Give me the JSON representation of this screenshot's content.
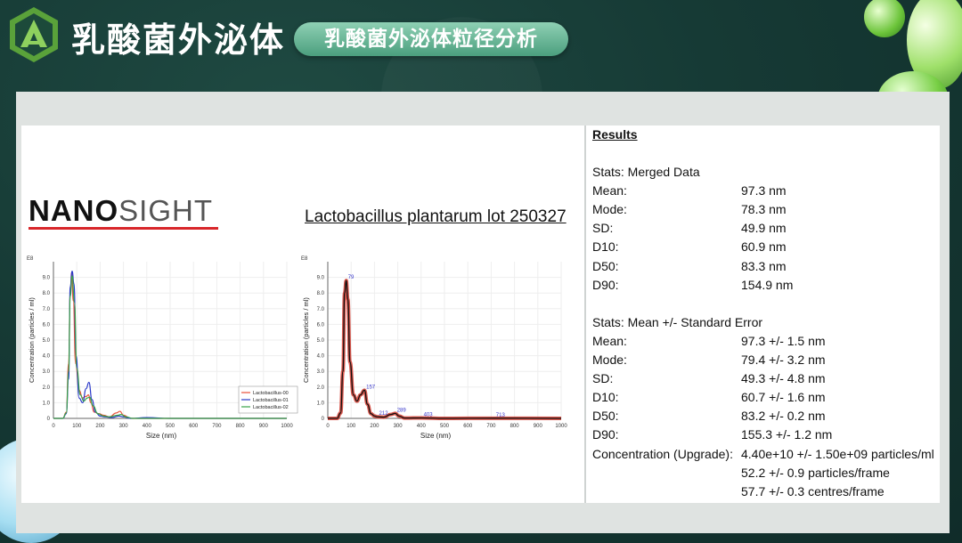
{
  "header": {
    "brand_title": "乳酸菌外泌体",
    "section_pill": "乳酸菌外泌体粒径分析"
  },
  "report": {
    "logo_text_bold": "NANO",
    "logo_text_light": "SIGHT",
    "sample_title": "Lactobacillus plantarum lot 250327"
  },
  "results": {
    "heading": "Results",
    "merged_heading": "Stats: Merged Data",
    "merged": [
      {
        "label": "Mean:",
        "value": "97.3 nm"
      },
      {
        "label": "Mode:",
        "value": "78.3 nm"
      },
      {
        "label": "SD:",
        "value": "49.9 nm"
      },
      {
        "label": "D10:",
        "value": "60.9 nm"
      },
      {
        "label": "D50:",
        "value": "83.3 nm"
      },
      {
        "label": "D90:",
        "value": "154.9 nm"
      }
    ],
    "se_heading": "Stats: Mean +/- Standard Error",
    "se": [
      {
        "label": "Mean:",
        "value": "97.3 +/- 1.5 nm"
      },
      {
        "label": "Mode:",
        "value": "79.4 +/- 3.2 nm"
      },
      {
        "label": "SD:",
        "value": "49.3 +/- 4.8 nm"
      },
      {
        "label": "D10:",
        "value": "60.7 +/- 1.6 nm"
      },
      {
        "label": "D50:",
        "value": "83.2 +/- 0.2 nm"
      },
      {
        "label": "D90:",
        "value": "155.3 +/- 1.2 nm"
      },
      {
        "label": "Concentration (Upgrade):",
        "value": "4.40e+10 +/- 1.50e+09 particles/ml"
      },
      {
        "label": "",
        "value": "52.2 +/- 0.9 particles/frame"
      },
      {
        "label": "",
        "value": "57.7 +/- 0.3 centres/frame"
      }
    ]
  },
  "chart_data": [
    {
      "type": "line",
      "xlabel": "Size (nm)",
      "ylabel": "Concentration (particles / ml)",
      "y_exponent_label": "E8",
      "xlim": [
        0,
        1000
      ],
      "ylim": [
        0,
        10
      ],
      "xticks": [
        "0",
        "100",
        "200",
        "300",
        "400",
        "500",
        "600",
        "700",
        "800",
        "900",
        "1000"
      ],
      "yticks": [
        "0",
        "1.0",
        "2.0",
        "3.0",
        "4.0",
        "5.0",
        "6.0",
        "7.0",
        "8.0",
        "9.0"
      ],
      "legend_position": "bottom-right",
      "series": [
        {
          "name": "Lactobacillus-00",
          "color": "#e8503a",
          "x": [
            0,
            40,
            55,
            65,
            72,
            78,
            85,
            95,
            110,
            125,
            140,
            150,
            160,
            175,
            195,
            215,
            240,
            270,
            285,
            300,
            330,
            400,
            500,
            700,
            1000
          ],
          "y": [
            0,
            0,
            0.4,
            3.5,
            8.0,
            9.3,
            7.5,
            3.5,
            1.8,
            1.3,
            1.4,
            1.5,
            1.0,
            0.4,
            0.3,
            0.2,
            0.1,
            0.35,
            0.45,
            0.2,
            0,
            0,
            0,
            0,
            0
          ]
        },
        {
          "name": "Lactobacillus-01",
          "color": "#2a39c9",
          "x": [
            0,
            40,
            55,
            65,
            72,
            80,
            88,
            97,
            110,
            125,
            140,
            152,
            165,
            180,
            200,
            220,
            250,
            280,
            300,
            330,
            400,
            500,
            700,
            1000
          ],
          "y": [
            0,
            0,
            0.3,
            2.5,
            8.4,
            9.4,
            8.6,
            4.0,
            1.3,
            1.0,
            1.9,
            2.3,
            1.2,
            0.4,
            0.15,
            0.1,
            0.05,
            0.15,
            0.1,
            0,
            0.05,
            0,
            0,
            0
          ]
        },
        {
          "name": "Lactobacillus-02",
          "color": "#3aa34a",
          "x": [
            0,
            40,
            55,
            65,
            72,
            80,
            90,
            100,
            115,
            130,
            145,
            155,
            170,
            190,
            215,
            240,
            275,
            290,
            310,
            340,
            400,
            500,
            700,
            1000
          ],
          "y": [
            0,
            0,
            0.35,
            3.0,
            7.8,
            9.1,
            7.4,
            3.2,
            1.5,
            1.1,
            1.3,
            1.35,
            0.8,
            0.3,
            0.15,
            0.1,
            0.2,
            0.25,
            0.1,
            0,
            0,
            0,
            0,
            0
          ]
        }
      ]
    },
    {
      "type": "line",
      "xlabel": "Size (nm)",
      "ylabel": "Concentration (particles / ml)",
      "y_exponent_label": "E8",
      "xlim": [
        0,
        1000
      ],
      "ylim": [
        0,
        10
      ],
      "xticks": [
        "0",
        "100",
        "200",
        "300",
        "400",
        "500",
        "600",
        "700",
        "800",
        "900",
        "1000"
      ],
      "yticks": [
        "0",
        "1.0",
        "2.0",
        "3.0",
        "4.0",
        "5.0",
        "6.0",
        "7.0",
        "8.0",
        "9.0"
      ],
      "series": [
        {
          "name": "",
          "color": "#111111",
          "x": [
            0,
            40,
            55,
            65,
            72,
            79,
            86,
            95,
            110,
            125,
            140,
            157,
            170,
            185,
            200,
            212,
            240,
            270,
            289,
            305,
            330,
            403,
            500,
            713,
            1000
          ],
          "y": [
            0,
            0,
            0.35,
            3.0,
            8.0,
            8.8,
            7.6,
            3.6,
            1.5,
            1.1,
            1.5,
            1.8,
            0.9,
            0.3,
            0.15,
            0.1,
            0.08,
            0.25,
            0.32,
            0.15,
            0.02,
            0.03,
            0,
            0.01,
            0
          ]
        }
      ],
      "peak_labels": [
        {
          "x": 79,
          "y": 8.8,
          "label": "79"
        },
        {
          "x": 157,
          "y": 1.8,
          "label": "157"
        },
        {
          "x": 212,
          "y": 0.1,
          "label": "212"
        },
        {
          "x": 289,
          "y": 0.32,
          "label": "289"
        },
        {
          "x": 403,
          "y": 0.03,
          "label": "403"
        },
        {
          "x": 713,
          "y": 0.01,
          "label": "713"
        }
      ]
    }
  ]
}
